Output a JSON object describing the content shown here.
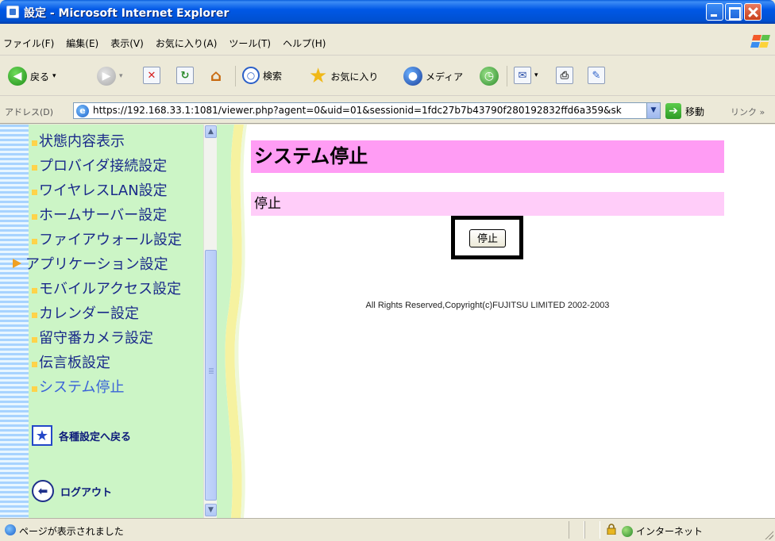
{
  "window": {
    "title": "設定 - Microsoft Internet Explorer"
  },
  "menu": [
    "ファイル(F)",
    "編集(E)",
    "表示(V)",
    "お気に入り(A)",
    "ツール(T)",
    "ヘルプ(H)"
  ],
  "toolbar": {
    "back": "戻る",
    "search": "検索",
    "favorites": "お気に入り",
    "media": "メディア"
  },
  "address": {
    "label": "アドレス(D)",
    "url": "https://192.168.33.1:1081/viewer.php?agent=0&uid=01&sessionid=1fdc27b7b43790f280192832ffd6a359&sk",
    "go": "移動",
    "links": "リンク »"
  },
  "sidebar": {
    "items": [
      {
        "label": "状態内容表示"
      },
      {
        "label": "プロバイダ接続設定"
      },
      {
        "label": "ワイヤレスLAN設定"
      },
      {
        "label": "ホームサーバー設定"
      },
      {
        "label": "ファイアウォール設定"
      }
    ],
    "group": {
      "label": "アプリケーション設定"
    },
    "children": [
      {
        "label": "モバイルアクセス設定"
      },
      {
        "label": "カレンダー設定"
      },
      {
        "label": "留守番カメラ設定"
      },
      {
        "label": "伝言板設定"
      },
      {
        "label": "システム停止"
      }
    ],
    "back_label": "各種設定へ戻る",
    "logout_label": "ログアウト"
  },
  "main": {
    "title": "システム停止",
    "section": "停止",
    "stop_button": "停止",
    "copyright": "All Rights Reserved,Copyright(c)FUJITSU LIMITED 2002-2003"
  },
  "status": {
    "message": "ページが表示されました",
    "zone": "インターネット"
  },
  "colors": {
    "title_bg": "#ff9cf4",
    "section_bg": "#ffcdf9",
    "sidebar_bg": "#ccf5c6"
  }
}
